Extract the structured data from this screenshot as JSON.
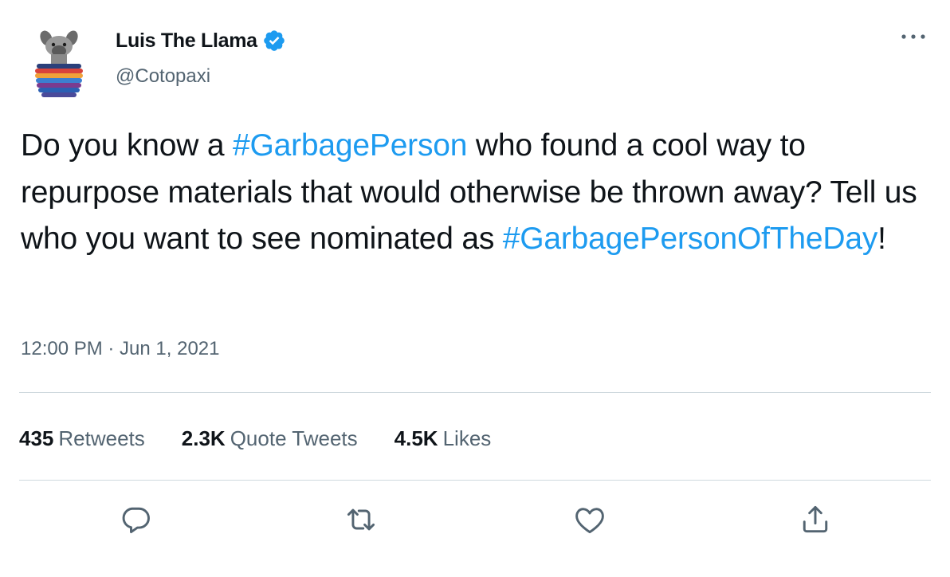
{
  "author": {
    "name": "Luis The Llama",
    "handle": "@Cotopaxi",
    "verified": true
  },
  "tweet": {
    "segments": [
      {
        "text": "Do you know a ",
        "hashtag": false
      },
      {
        "text": "#GarbagePerson",
        "hashtag": true
      },
      {
        "text": " who found a cool way to repurpose materials that would otherwise be thrown away? Tell us who you want to see nominated as ",
        "hashtag": false
      },
      {
        "text": "#GarbagePersonOfTheDay",
        "hashtag": true
      },
      {
        "text": "!",
        "hashtag": false
      }
    ],
    "timestamp": "12:00 PM · Jun 1, 2021"
  },
  "stats": {
    "retweets": {
      "count": "435",
      "label": "Retweets"
    },
    "quotes": {
      "count": "2.3K",
      "label": "Quote Tweets"
    },
    "likes": {
      "count": "4.5K",
      "label": "Likes"
    }
  },
  "actions": [
    "reply-icon",
    "retweet-icon",
    "like-icon",
    "share-icon"
  ],
  "colors": {
    "accent": "#1d9bf0",
    "text": "#0f1419",
    "secondary": "#536471",
    "divider": "#cfd9de"
  }
}
